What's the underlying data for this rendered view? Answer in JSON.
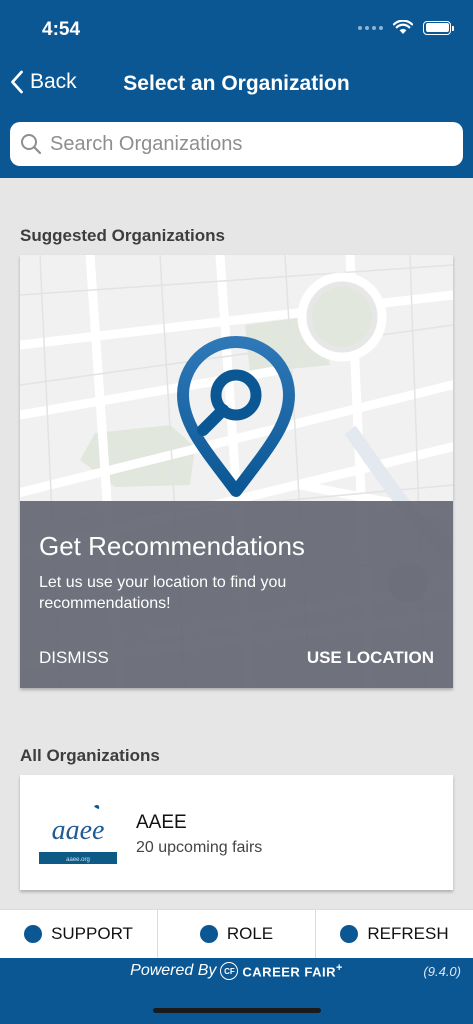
{
  "status_bar": {
    "time": "4:54"
  },
  "nav": {
    "back_label": "Back",
    "title": "Select an Organization"
  },
  "search": {
    "placeholder": "Search Organizations",
    "value": ""
  },
  "suggested": {
    "section_title": "Suggested Organizations",
    "card": {
      "title": "Get Recommendations",
      "description": "Let us use your location to find you recommendations!",
      "dismiss_label": "DISMISS",
      "use_location_label": "USE LOCATION"
    }
  },
  "all_orgs": {
    "section_title": "All Organizations",
    "items": [
      {
        "name": "AAEE",
        "subtitle": "20 upcoming fairs",
        "logo_text": "aaee",
        "logo_url_text": "aaee.org"
      }
    ]
  },
  "bottom_bar": {
    "buttons": [
      {
        "label": "SUPPORT"
      },
      {
        "label": "ROLE"
      },
      {
        "label": "REFRESH"
      }
    ]
  },
  "footer": {
    "powered_by": "Powered By",
    "logo_mark": "CF",
    "brand": "CAREER FAIR",
    "brand_mark": "+",
    "version": "(9.4.0)"
  },
  "colors": {
    "brand_blue": "#0b5794",
    "overlay_gray": "#646672",
    "page_background": "#e6e6e6"
  },
  "icons": {
    "back": "chevron-left-icon",
    "search": "search-icon",
    "location": "location-pin-icon",
    "wifi": "wifi-icon",
    "battery": "battery-icon"
  }
}
